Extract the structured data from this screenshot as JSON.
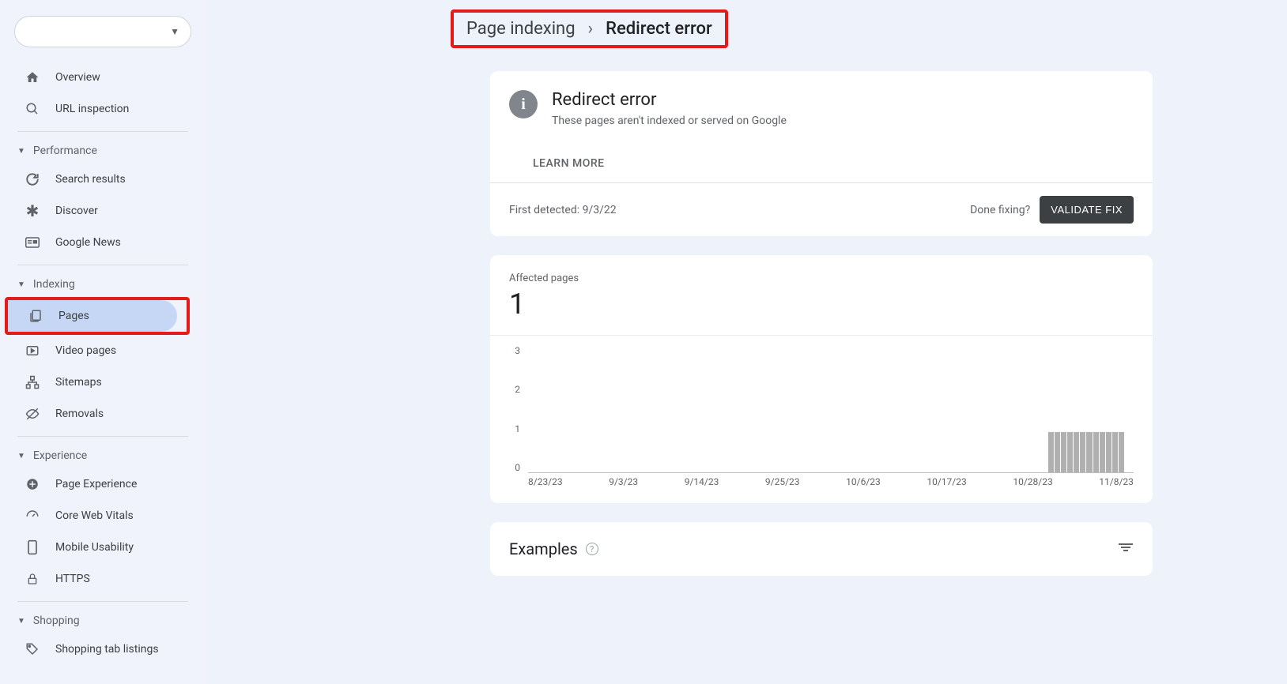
{
  "sidebar": {
    "overview": "Overview",
    "url_inspection": "URL inspection",
    "performance_section": "Performance",
    "search_results": "Search results",
    "discover": "Discover",
    "google_news": "Google News",
    "indexing_section": "Indexing",
    "pages": "Pages",
    "video_pages": "Video pages",
    "sitemaps": "Sitemaps",
    "removals": "Removals",
    "experience_section": "Experience",
    "page_experience": "Page Experience",
    "core_web_vitals": "Core Web Vitals",
    "mobile_usability": "Mobile Usability",
    "https": "HTTPS",
    "shopping_section": "Shopping",
    "shopping_tab": "Shopping tab listings"
  },
  "breadcrumb": {
    "parent": "Page indexing",
    "current": "Redirect error"
  },
  "status_card": {
    "title": "Redirect error",
    "subtitle": "These pages aren't indexed or served on Google",
    "learn_more": "LEARN MORE",
    "first_detected_label": "First detected: 9/3/22",
    "done_fixing": "Done fixing?",
    "validate_fix": "VALIDATE FIX"
  },
  "affected": {
    "label": "Affected pages",
    "count": "1"
  },
  "chart_data": {
    "type": "bar",
    "title": "Affected pages",
    "ylabel": "",
    "xlabel": "",
    "ylim": [
      0,
      3
    ],
    "y_ticks": [
      "3",
      "2",
      "1",
      "0"
    ],
    "categories": [
      "8/23/23",
      "9/3/23",
      "9/14/23",
      "9/25/23",
      "10/6/23",
      "10/17/23",
      "10/28/23",
      "11/8/23"
    ],
    "values": [
      0,
      0,
      0,
      0,
      0,
      0,
      0,
      1
    ]
  },
  "examples": {
    "title": "Examples"
  }
}
